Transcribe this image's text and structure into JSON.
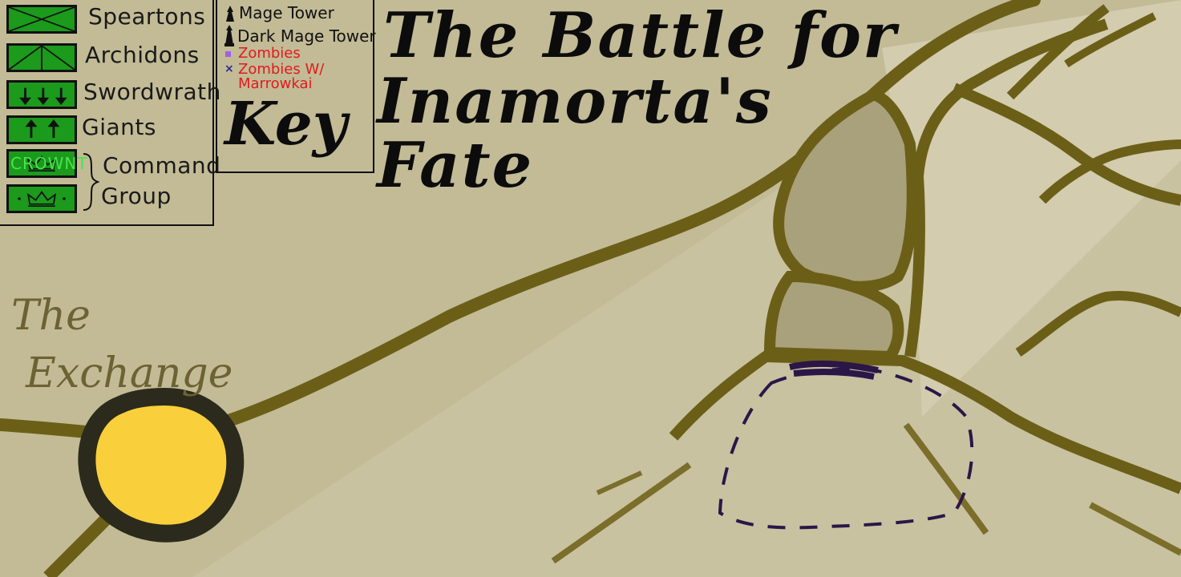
{
  "title": {
    "line1": "The Battle for",
    "line2": "Inamorta's",
    "line3": "Fate"
  },
  "legend": {
    "units": [
      {
        "label": "Speartons",
        "icon": "x-box-icon"
      },
      {
        "label": "Archidons",
        "icon": "bow-box-icon"
      },
      {
        "label": "Swordwrath",
        "icon": "three-arrows-icon"
      },
      {
        "label": "Giants",
        "icon": "two-arrows-icon"
      },
      {
        "label": "Command",
        "icon": "crown-icon"
      },
      {
        "label": "Group",
        "icon": "crown-icon"
      }
    ],
    "crown_text": "CROWNT",
    "key_items": [
      {
        "label": "Mage Tower",
        "icon": "tower-icon"
      },
      {
        "label": "Dark Mage Tower",
        "icon": "dark-tower-icon"
      },
      {
        "label": "Zombies",
        "icon": "purple-square-icon"
      },
      {
        "label": "Zombies W/",
        "icon": "blue-x-icon"
      },
      {
        "label": "Marrowkai",
        "icon": ""
      }
    ],
    "key_title": "Key"
  },
  "places": {
    "exchange_line1": "The",
    "exchange_line2": "Exchange"
  },
  "colors": {
    "ground": "#c2bb96",
    "road": "#6b5f18",
    "unit_green": "#1b9a1b",
    "zombie_red": "#e01b1b",
    "marker_yellow": "#f9cf3b",
    "zone_purple": "#2a1747"
  }
}
